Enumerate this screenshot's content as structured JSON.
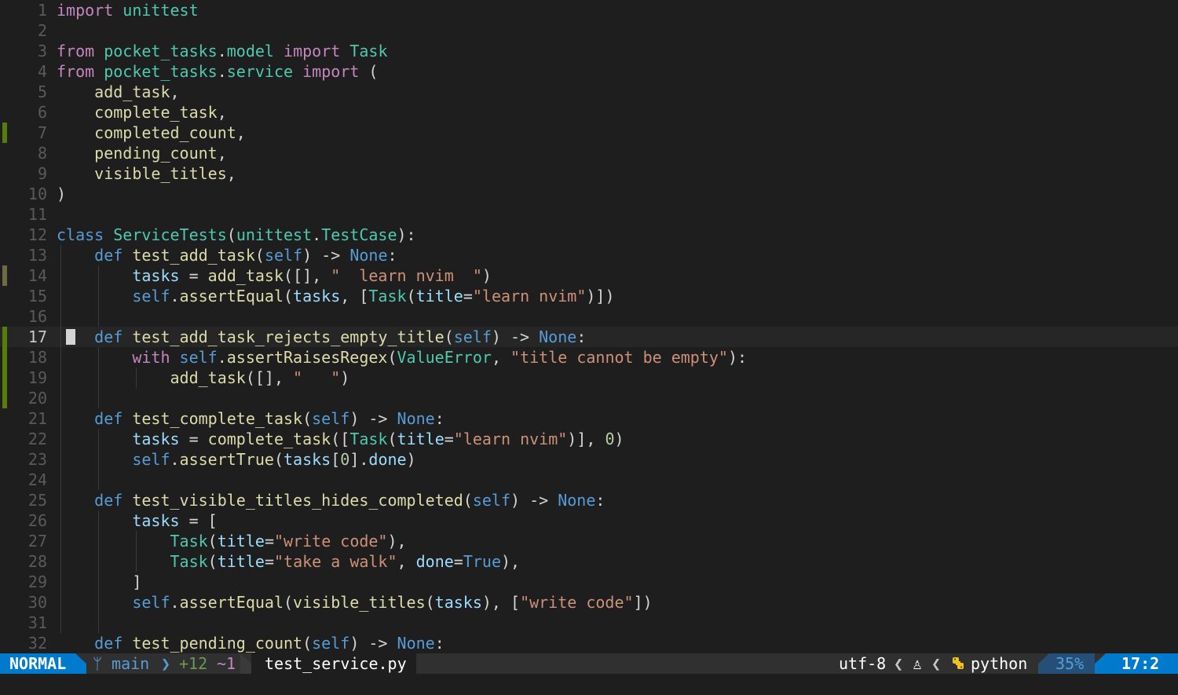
{
  "editor": {
    "current_line": 17,
    "lines": [
      {
        "n": "1",
        "tokens": [
          [
            "kw",
            "import"
          ],
          [
            "plain",
            " "
          ],
          [
            "mod",
            "unittest"
          ]
        ]
      },
      {
        "n": "2",
        "tokens": []
      },
      {
        "n": "3",
        "tokens": [
          [
            "kw",
            "from"
          ],
          [
            "plain",
            " "
          ],
          [
            "mod",
            "pocket_tasks"
          ],
          [
            "plain",
            "."
          ],
          [
            "mod",
            "model"
          ],
          [
            "plain",
            " "
          ],
          [
            "kw",
            "import"
          ],
          [
            "plain",
            " "
          ],
          [
            "cls",
            "Task"
          ]
        ]
      },
      {
        "n": "4",
        "tokens": [
          [
            "kw",
            "from"
          ],
          [
            "plain",
            " "
          ],
          [
            "mod",
            "pocket_tasks"
          ],
          [
            "plain",
            "."
          ],
          [
            "mod",
            "service"
          ],
          [
            "plain",
            " "
          ],
          [
            "kw",
            "import"
          ],
          [
            "plain",
            " ("
          ]
        ]
      },
      {
        "n": "5",
        "tokens": [
          [
            "plain",
            "    "
          ],
          [
            "fn",
            "add_task"
          ],
          [
            "plain",
            ","
          ]
        ]
      },
      {
        "n": "6",
        "tokens": [
          [
            "plain",
            "    "
          ],
          [
            "fn",
            "complete_task"
          ],
          [
            "plain",
            ","
          ]
        ]
      },
      {
        "n": "7",
        "sign": "add",
        "tokens": [
          [
            "plain",
            "    "
          ],
          [
            "fn",
            "completed_count"
          ],
          [
            "plain",
            ","
          ]
        ]
      },
      {
        "n": "8",
        "tokens": [
          [
            "plain",
            "    "
          ],
          [
            "fn",
            "pending_count"
          ],
          [
            "plain",
            ","
          ]
        ]
      },
      {
        "n": "9",
        "tokens": [
          [
            "plain",
            "    "
          ],
          [
            "fn",
            "visible_titles"
          ],
          [
            "plain",
            ","
          ]
        ]
      },
      {
        "n": "10",
        "tokens": [
          [
            "plain",
            ")"
          ]
        ]
      },
      {
        "n": "11",
        "tokens": []
      },
      {
        "n": "12",
        "tokens": [
          [
            "def",
            "class"
          ],
          [
            "plain",
            " "
          ],
          [
            "cls",
            "ServiceTests"
          ],
          [
            "plain",
            "("
          ],
          [
            "mod",
            "unittest"
          ],
          [
            "plain",
            "."
          ],
          [
            "cls",
            "TestCase"
          ],
          [
            "plain",
            "):"
          ]
        ]
      },
      {
        "n": "13",
        "tokens": [
          [
            "plain",
            "    "
          ],
          [
            "def",
            "def"
          ],
          [
            "plain",
            " "
          ],
          [
            "fn",
            "test_add_task"
          ],
          [
            "plain",
            "("
          ],
          [
            "self",
            "self"
          ],
          [
            "plain",
            ") -> "
          ],
          [
            "def",
            "None"
          ],
          [
            "plain",
            ":"
          ]
        ]
      },
      {
        "n": "14",
        "sign": "chg",
        "tokens": [
          [
            "plain",
            "        "
          ],
          [
            "var",
            "tasks"
          ],
          [
            "plain",
            " = "
          ],
          [
            "fn",
            "add_task"
          ],
          [
            "plain",
            "([], "
          ],
          [
            "str",
            "\"  learn nvim  \""
          ],
          [
            "plain",
            ")"
          ]
        ]
      },
      {
        "n": "15",
        "tokens": [
          [
            "plain",
            "        "
          ],
          [
            "self",
            "self"
          ],
          [
            "plain",
            "."
          ],
          [
            "fn",
            "assertEqual"
          ],
          [
            "plain",
            "("
          ],
          [
            "var",
            "tasks"
          ],
          [
            "plain",
            ", ["
          ],
          [
            "cls",
            "Task"
          ],
          [
            "plain",
            "("
          ],
          [
            "kwarg",
            "title"
          ],
          [
            "plain",
            "="
          ],
          [
            "str",
            "\"learn nvim\""
          ],
          [
            "plain",
            ")])"
          ]
        ]
      },
      {
        "n": "16",
        "tokens": []
      },
      {
        "n": "17",
        "sign": "add",
        "tokens": [
          [
            "plain",
            "    "
          ],
          [
            "def",
            "def"
          ],
          [
            "plain",
            " "
          ],
          [
            "fn",
            "test_add_task_rejects_empty_title"
          ],
          [
            "plain",
            "("
          ],
          [
            "self",
            "self"
          ],
          [
            "plain",
            ") -> "
          ],
          [
            "def",
            "None"
          ],
          [
            "plain",
            ":"
          ]
        ]
      },
      {
        "n": "18",
        "sign": "add",
        "tokens": [
          [
            "plain",
            "        "
          ],
          [
            "kw",
            "with"
          ],
          [
            "plain",
            " "
          ],
          [
            "self",
            "self"
          ],
          [
            "plain",
            "."
          ],
          [
            "fn",
            "assertRaisesRegex"
          ],
          [
            "plain",
            "("
          ],
          [
            "cls",
            "ValueError"
          ],
          [
            "plain",
            ", "
          ],
          [
            "str",
            "\"title cannot be empty\""
          ],
          [
            "plain",
            "):"
          ]
        ]
      },
      {
        "n": "19",
        "sign": "add",
        "tokens": [
          [
            "plain",
            "            "
          ],
          [
            "fn",
            "add_task"
          ],
          [
            "plain",
            "([], "
          ],
          [
            "str",
            "\"   \""
          ],
          [
            "plain",
            ")"
          ]
        ]
      },
      {
        "n": "20",
        "sign": "add",
        "tokens": []
      },
      {
        "n": "21",
        "tokens": [
          [
            "plain",
            "    "
          ],
          [
            "def",
            "def"
          ],
          [
            "plain",
            " "
          ],
          [
            "fn",
            "test_complete_task"
          ],
          [
            "plain",
            "("
          ],
          [
            "self",
            "self"
          ],
          [
            "plain",
            ") -> "
          ],
          [
            "def",
            "None"
          ],
          [
            "plain",
            ":"
          ]
        ]
      },
      {
        "n": "22",
        "tokens": [
          [
            "plain",
            "        "
          ],
          [
            "var",
            "tasks"
          ],
          [
            "plain",
            " = "
          ],
          [
            "fn",
            "complete_task"
          ],
          [
            "plain",
            "(["
          ],
          [
            "cls",
            "Task"
          ],
          [
            "plain",
            "("
          ],
          [
            "kwarg",
            "title"
          ],
          [
            "plain",
            "="
          ],
          [
            "str",
            "\"learn nvim\""
          ],
          [
            "plain",
            ")], "
          ],
          [
            "num",
            "0"
          ],
          [
            "plain",
            ")"
          ]
        ]
      },
      {
        "n": "23",
        "tokens": [
          [
            "plain",
            "        "
          ],
          [
            "self",
            "self"
          ],
          [
            "plain",
            "."
          ],
          [
            "fn",
            "assertTrue"
          ],
          [
            "plain",
            "("
          ],
          [
            "var",
            "tasks"
          ],
          [
            "plain",
            "["
          ],
          [
            "num",
            "0"
          ],
          [
            "plain",
            "]."
          ],
          [
            "var",
            "done"
          ],
          [
            "plain",
            ")"
          ]
        ]
      },
      {
        "n": "24",
        "tokens": []
      },
      {
        "n": "25",
        "tokens": [
          [
            "plain",
            "    "
          ],
          [
            "def",
            "def"
          ],
          [
            "plain",
            " "
          ],
          [
            "fn",
            "test_visible_titles_hides_completed"
          ],
          [
            "plain",
            "("
          ],
          [
            "self",
            "self"
          ],
          [
            "plain",
            ") -> "
          ],
          [
            "def",
            "None"
          ],
          [
            "plain",
            ":"
          ]
        ]
      },
      {
        "n": "26",
        "tokens": [
          [
            "plain",
            "        "
          ],
          [
            "var",
            "tasks"
          ],
          [
            "plain",
            " = ["
          ]
        ]
      },
      {
        "n": "27",
        "tokens": [
          [
            "plain",
            "            "
          ],
          [
            "cls",
            "Task"
          ],
          [
            "plain",
            "("
          ],
          [
            "kwarg",
            "title"
          ],
          [
            "plain",
            "="
          ],
          [
            "str",
            "\"write code\""
          ],
          [
            "plain",
            "),"
          ]
        ]
      },
      {
        "n": "28",
        "tokens": [
          [
            "plain",
            "            "
          ],
          [
            "cls",
            "Task"
          ],
          [
            "plain",
            "("
          ],
          [
            "kwarg",
            "title"
          ],
          [
            "plain",
            "="
          ],
          [
            "str",
            "\"take a walk\""
          ],
          [
            "plain",
            ", "
          ],
          [
            "kwarg",
            "done"
          ],
          [
            "plain",
            "="
          ],
          [
            "def",
            "True"
          ],
          [
            "plain",
            "),"
          ]
        ]
      },
      {
        "n": "29",
        "tokens": [
          [
            "plain",
            "        ]"
          ]
        ]
      },
      {
        "n": "30",
        "tokens": [
          [
            "plain",
            "        "
          ],
          [
            "self",
            "self"
          ],
          [
            "plain",
            "."
          ],
          [
            "fn",
            "assertEqual"
          ],
          [
            "plain",
            "("
          ],
          [
            "fn",
            "visible_titles"
          ],
          [
            "plain",
            "("
          ],
          [
            "var",
            "tasks"
          ],
          [
            "plain",
            "), ["
          ],
          [
            "str",
            "\"write code\""
          ],
          [
            "plain",
            "])"
          ]
        ]
      },
      {
        "n": "31",
        "tokens": []
      },
      {
        "n": "32",
        "tokens": [
          [
            "plain",
            "    "
          ],
          [
            "def",
            "def"
          ],
          [
            "plain",
            " "
          ],
          [
            "fn",
            "test_pending_count"
          ],
          [
            "plain",
            "("
          ],
          [
            "self",
            "self"
          ],
          [
            "plain",
            ") -> "
          ],
          [
            "def",
            "None"
          ],
          [
            "plain",
            ":"
          ]
        ]
      }
    ]
  },
  "statusbar": {
    "mode": "NORMAL",
    "branch_icon": "git-branch-icon",
    "branch": "main",
    "separator": "❯",
    "added": "+12",
    "changed": "~1",
    "filename": "test_service.py",
    "encoding": "utf-8",
    "sep": "❮",
    "os_icon": "linux-icon",
    "os_glyph": "♙",
    "filetype_icon": "python-icon",
    "filetype": "python",
    "percent": "35%",
    "position": "17:2"
  },
  "colors": {
    "accent": "#007acc",
    "background": "#1e1e1e",
    "git_add": "#587c0c",
    "git_change": "#6f6a45"
  }
}
